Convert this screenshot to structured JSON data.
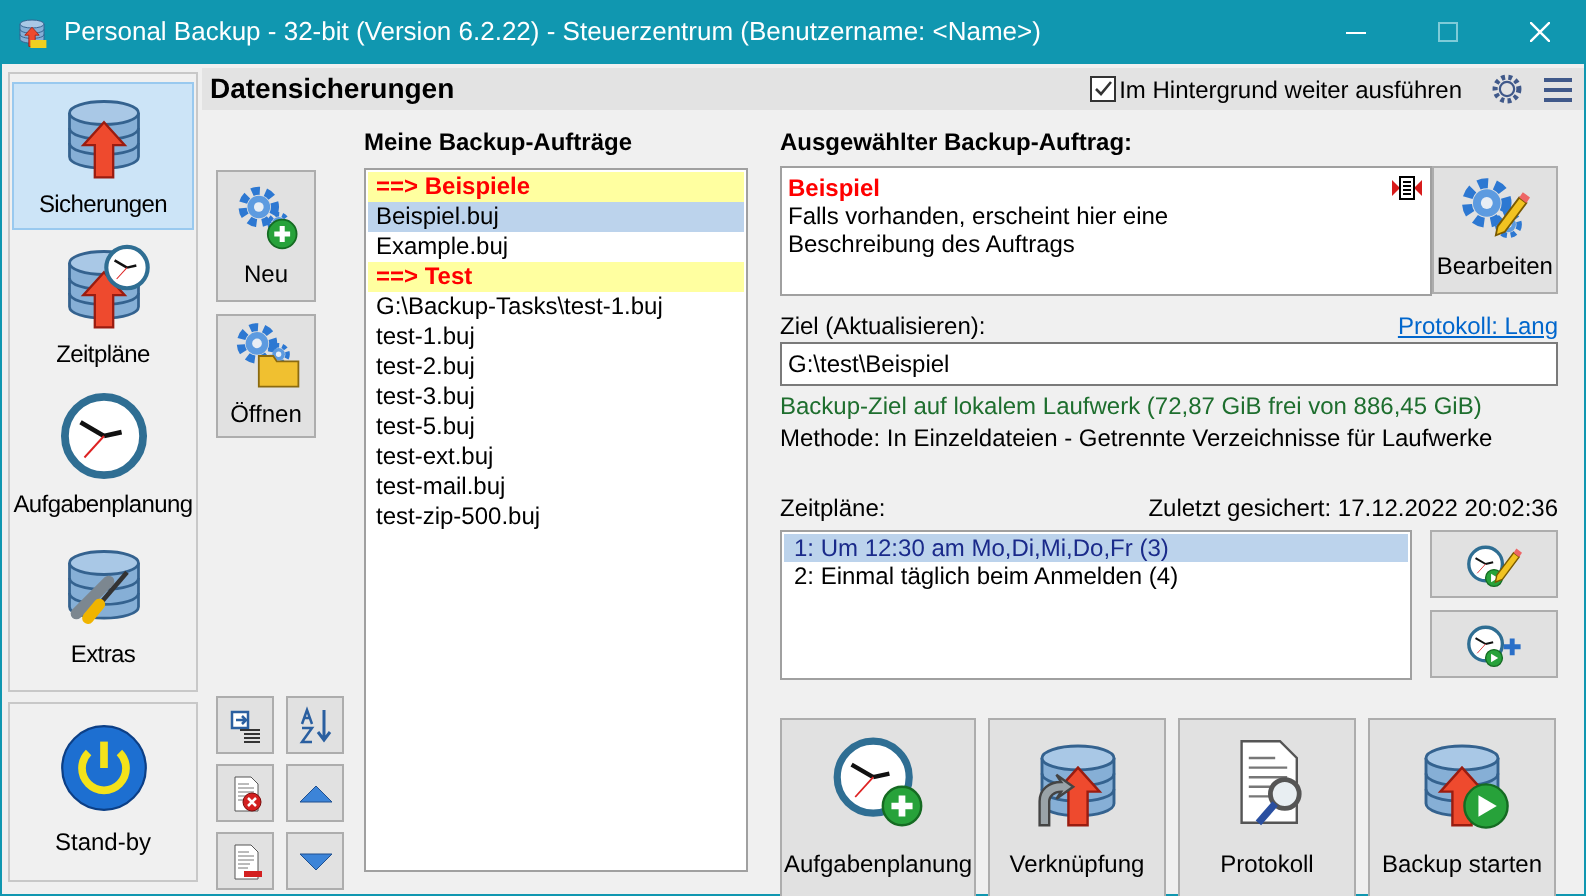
{
  "window": {
    "title": "Personal Backup - 32-bit (Version 6.2.22) - Steuerzentrum (Benutzername: <Name>)"
  },
  "sidebar": {
    "items": [
      {
        "kind": "backups",
        "label": "Sicherungen",
        "selected": true
      },
      {
        "kind": "schedules",
        "label": "Zeitpläne",
        "selected": false
      },
      {
        "kind": "tasks",
        "label": "Aufgabenplanung",
        "selected": false
      },
      {
        "kind": "extras",
        "label": "Extras",
        "selected": false
      }
    ],
    "standby": {
      "label": "Stand-by"
    }
  },
  "header": {
    "title": "Datensicherungen",
    "background_option": {
      "label": "Im Hintergrund weiter ausführen",
      "checked": true
    }
  },
  "jobs": {
    "title": "Meine Backup-Aufträge",
    "buttons": [
      {
        "kind": "new",
        "label": "Neu"
      },
      {
        "kind": "open",
        "label": "Öffnen"
      }
    ],
    "items": [
      {
        "kind": "group",
        "label": "==> Beispiele",
        "selected": false
      },
      {
        "kind": "file",
        "label": "Beispiel.buj",
        "selected": true
      },
      {
        "kind": "file",
        "label": "Example.buj",
        "selected": false
      },
      {
        "kind": "group",
        "label": "==> Test",
        "selected": false
      },
      {
        "kind": "file",
        "label": "G:\\Backup-Tasks\\test-1.buj",
        "selected": false
      },
      {
        "kind": "file",
        "label": "test-1.buj",
        "selected": false
      },
      {
        "kind": "file",
        "label": "test-2.buj",
        "selected": false
      },
      {
        "kind": "file",
        "label": "test-3.buj",
        "selected": false
      },
      {
        "kind": "file",
        "label": "test-5.buj",
        "selected": false
      },
      {
        "kind": "file",
        "label": "test-ext.buj",
        "selected": false
      },
      {
        "kind": "file",
        "label": "test-mail.buj",
        "selected": false
      },
      {
        "kind": "file",
        "label": "test-zip-500.buj",
        "selected": false
      }
    ]
  },
  "selected_job": {
    "title": "Ausgewählter Backup-Auftrag:",
    "name": "Beispiel",
    "description": "Falls vorhanden, erscheint hier eine Beschreibung des Auftrags",
    "edit_button": "Bearbeiten",
    "target_label": "Ziel (Aktualisieren):",
    "log_link": "Protokoll: Lang",
    "target": "G:\\test\\Beispiel",
    "target_info": "Backup-Ziel auf lokalem Laufwerk (72,87 GiB frei von 886,45 GiB)",
    "method": "Methode: In Einzeldateien - Getrennte Verzeichnisse für Laufwerke"
  },
  "schedules": {
    "title": "Zeitpläne:",
    "last_backup": "Zuletzt gesichert: 17.12.2022 20:02:36",
    "items": [
      {
        "label": "1: Um 12:30 am Mo,Di,Mi,Do,Fr (3)",
        "selected": true
      },
      {
        "label": "2: Einmal täglich beim Anmelden (4)",
        "selected": false
      }
    ]
  },
  "actions": [
    {
      "kind": "task",
      "label": "Aufgabenplanung"
    },
    {
      "kind": "shortcut",
      "label": "Verknüpfung"
    },
    {
      "kind": "log",
      "label": "Protokoll"
    },
    {
      "kind": "start",
      "label": "Backup starten"
    }
  ]
}
